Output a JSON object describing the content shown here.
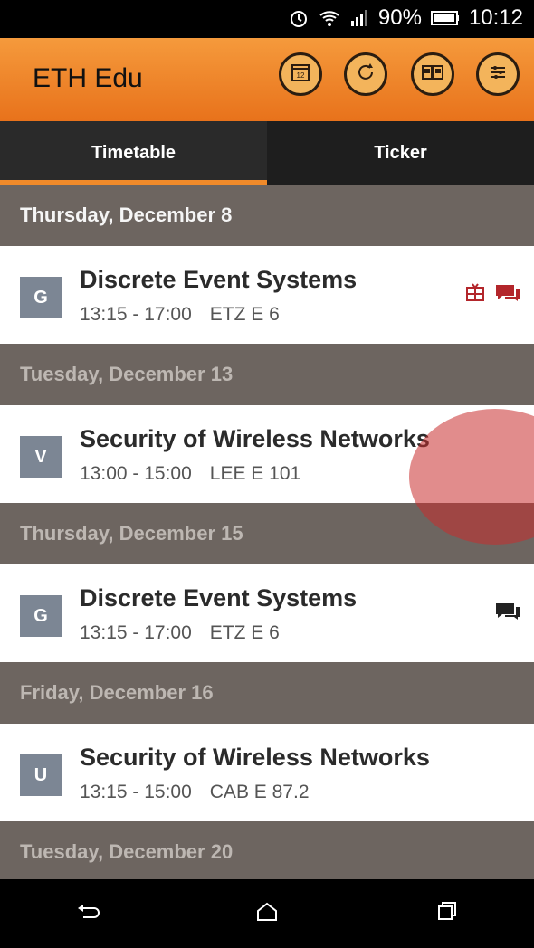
{
  "status_bar": {
    "battery_text": "90%",
    "time": "10:12",
    "icons": [
      "alarm-icon",
      "wifi-icon",
      "signal-icon",
      "battery-icon"
    ]
  },
  "app_bar": {
    "title": "ETH Edu",
    "calendar_day": "12",
    "actions": [
      "calendar-icon",
      "refresh-icon",
      "book-icon",
      "settings-icon"
    ]
  },
  "tabs": [
    {
      "label": "Timetable",
      "active": true
    },
    {
      "label": "Ticker",
      "active": false
    }
  ],
  "entries": [
    {
      "date": "Thursday, December 8",
      "type": "G",
      "title": "Discrete Event Systems",
      "time": "13:15 - 17:00",
      "room": "ETZ E 6",
      "icons": [
        "tv-icon",
        "chat-icon"
      ]
    },
    {
      "date": "Tuesday, December 13",
      "type": "V",
      "title": "Security of Wireless Networks",
      "time": "13:00 - 15:00",
      "room": "LEE E 101",
      "icons": []
    },
    {
      "date": "Thursday, December 15",
      "type": "G",
      "title": "Discrete Event Systems",
      "time": "13:15 - 17:00",
      "room": "ETZ E 6",
      "icons": [
        "chat-icon"
      ]
    },
    {
      "date": "Friday, December 16",
      "type": "U",
      "title": "Security of Wireless Networks",
      "time": "13:15 - 15:00",
      "room": "CAB E 87.2",
      "icons": []
    },
    {
      "date": "Tuesday, December 20"
    }
  ],
  "navigation": [
    "back-icon",
    "home-icon",
    "recents-icon"
  ],
  "colors": {
    "accent": "#f08a2a",
    "highlight": "#c82d2d"
  }
}
